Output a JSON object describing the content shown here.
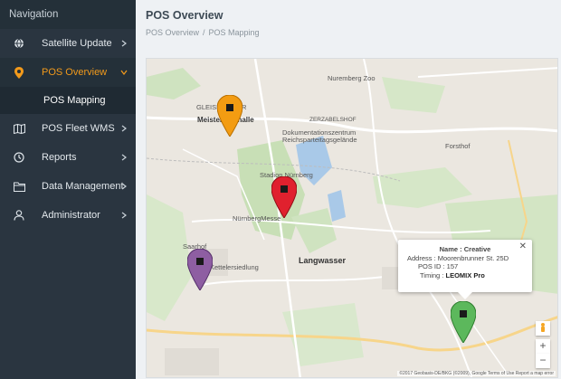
{
  "sidebar": {
    "title": "Navigation",
    "items": [
      {
        "label": "Satellite Update",
        "icon": "globe-icon"
      },
      {
        "label": "POS Overview",
        "icon": "map-pin-icon",
        "active": true
      },
      {
        "label": "POS Fleet WMS",
        "icon": "map-fold-icon"
      },
      {
        "label": "Reports",
        "icon": "clock-icon"
      },
      {
        "label": "Data Management",
        "icon": "folder-icon"
      },
      {
        "label": "Administrator",
        "icon": "user-icon"
      }
    ],
    "sub_item": "POS Mapping",
    "active_color": "#f29a1b"
  },
  "header": {
    "title": "POS Overview",
    "breadcrumb": [
      "POS Overview",
      "POS Mapping"
    ],
    "breadcrumb_sep": "/"
  },
  "map": {
    "labels": {
      "nuremberg_zoo": "Nuremberg Zoo",
      "gleisharhof": "GLEISHAMMER",
      "meistersingerhalle": "Meistersinghalle",
      "zerzabelshof": "ZERZABELSHOF",
      "dokuzentrum": "Dokumentationszentrum Reichsparteitagsgelände",
      "forsthof": "Forsthof",
      "stadion": "Stadion Nürnberg",
      "messe": "NürnbergMesse",
      "langwasser": "Langwasser",
      "kettelersiedlung": "Kettelersiedlung",
      "saarhof": "Saarhof"
    },
    "pins": [
      {
        "name": "orange-pin",
        "color": "#f39c12"
      },
      {
        "name": "red-pin",
        "color": "#e0212e"
      },
      {
        "name": "purple-pin",
        "color": "#8e5ea2"
      },
      {
        "name": "green-pin",
        "color": "#5cb85c"
      }
    ],
    "info": {
      "name": "Name : Creative",
      "address": "Address : Moorenbrunner St. 25D",
      "pos_id": "POS ID : 157",
      "timing_label": "Timing :",
      "timing_value": "LEOMIX Pro",
      "close": "✕"
    },
    "zoom_in": "+",
    "zoom_out": "−",
    "attribution": "©2017 Geobasis-DE/BKG (©2009), Google   Terms of Use   Report a map error"
  }
}
